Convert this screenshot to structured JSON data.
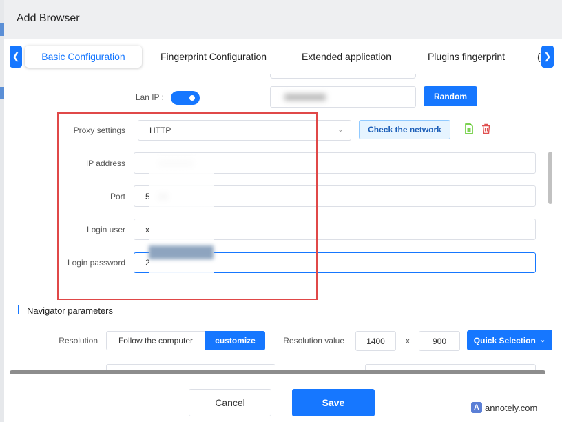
{
  "dialog": {
    "title": "Add Browser"
  },
  "tabs": [
    {
      "label": "Basic Configuration",
      "active": true
    },
    {
      "label": "Fingerprint Configuration",
      "active": false
    },
    {
      "label": "Extended application",
      "active": false
    },
    {
      "label": "Plugins fingerprint",
      "active": false
    }
  ],
  "form": {
    "lan_ip": {
      "label": "Lan IP :",
      "enabled": true
    },
    "random_button": "Random",
    "proxy": {
      "label": "Proxy settings",
      "value": "HTTP",
      "check_button": "Check the network"
    },
    "ip_address": {
      "label": "IP address"
    },
    "port": {
      "label": "Port",
      "value": "5"
    },
    "login_user": {
      "label": "Login user",
      "value": "x"
    },
    "login_password": {
      "label": "Login password",
      "value": "2"
    }
  },
  "navigator": {
    "section_title": "Navigator parameters",
    "resolution_label": "Resolution",
    "follow_option": "Follow the computer",
    "customize_option": "customize",
    "resolution_value_label": "Resolution value",
    "width": "1400",
    "times": "x",
    "height": "900",
    "quick_selection": "Quick Selection"
  },
  "footer": {
    "cancel": "Cancel",
    "save": "Save"
  },
  "watermark": {
    "text": "annotely.com"
  },
  "colors": {
    "primary": "#1677ff",
    "annotation": "#e04848"
  }
}
